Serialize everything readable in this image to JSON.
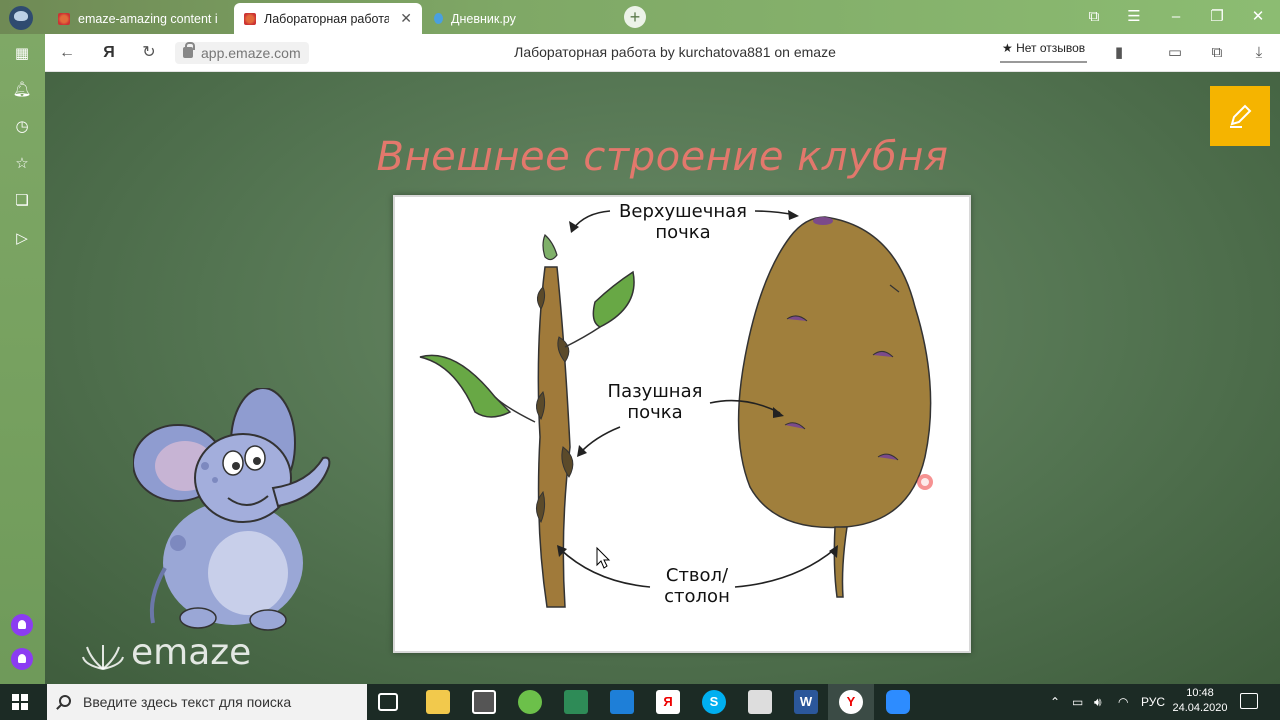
{
  "browser": {
    "tabs": [
      {
        "title": "emaze-amazing content in",
        "favicon": "emaze-favicon",
        "active": false
      },
      {
        "title": "Лабораторная работа by",
        "favicon": "emaze-favicon",
        "active": true
      },
      {
        "title": "Дневник.ру",
        "favicon": "dnevnik-favicon",
        "active": false
      }
    ],
    "new_tab_label": "+",
    "url": "app.emaze.com",
    "page_title": "Лабораторная работа by kurchatova881 on emaze",
    "reviews_label": "★ Нет отзывов",
    "accent_color": "#7fa866"
  },
  "slide": {
    "title": "Внешнее строение клубня",
    "title_color": "#e2786c",
    "labels": {
      "apical_bud": "Верхушечная\nпочка",
      "axillary_bud": "Пазушная\nпочка",
      "stolon": "Ствол/\nстолон"
    },
    "brand": "emaze",
    "edit_button_color": "#f5b400"
  },
  "taskbar": {
    "search_placeholder": "Введите здесь текст для поиска",
    "language": "РУС",
    "time": "10:48",
    "date": "24.04.2020"
  }
}
